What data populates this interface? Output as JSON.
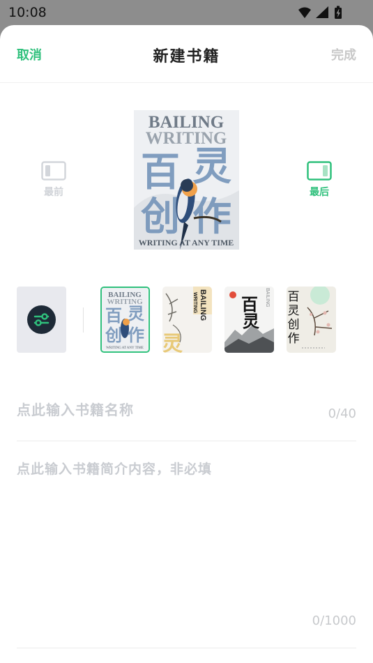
{
  "status": {
    "time": "10:08"
  },
  "header": {
    "cancel": "取消",
    "title": "新建书籍",
    "done": "完成"
  },
  "position": {
    "front_label": "最前",
    "back_label": "最后",
    "front_color": "#d0d3d8",
    "back_color": "#2fc07c"
  },
  "cover": {
    "line1": "BAILING",
    "line2": "WRITING",
    "chars": [
      "百",
      "灵",
      "创",
      "作"
    ],
    "tagline": "WRITING AT ANY TIME"
  },
  "thumbnails": {
    "t1": {
      "line1": "BAILING",
      "line2": "WRITING",
      "chars": [
        "百",
        "灵",
        "创",
        "作"
      ],
      "tagline": "WRITING AT ANY TIME"
    },
    "t2": {
      "en1": "BAILING",
      "en2": "WRITING",
      "char": "灵"
    },
    "t3": {
      "chars": [
        "百",
        "灵"
      ],
      "en": "BAILING"
    },
    "t4": {
      "chars": [
        "百",
        "灵",
        "创",
        "作"
      ]
    }
  },
  "form": {
    "name_placeholder": "点此输入书籍名称",
    "name_count": "0/40",
    "intro_placeholder": "点此输入书籍简介内容，非必填",
    "intro_count": "0/1000"
  },
  "colors": {
    "accent": "#2fc07c",
    "muted": "#c8c8c8",
    "dark_icon": "#1e2a37"
  }
}
